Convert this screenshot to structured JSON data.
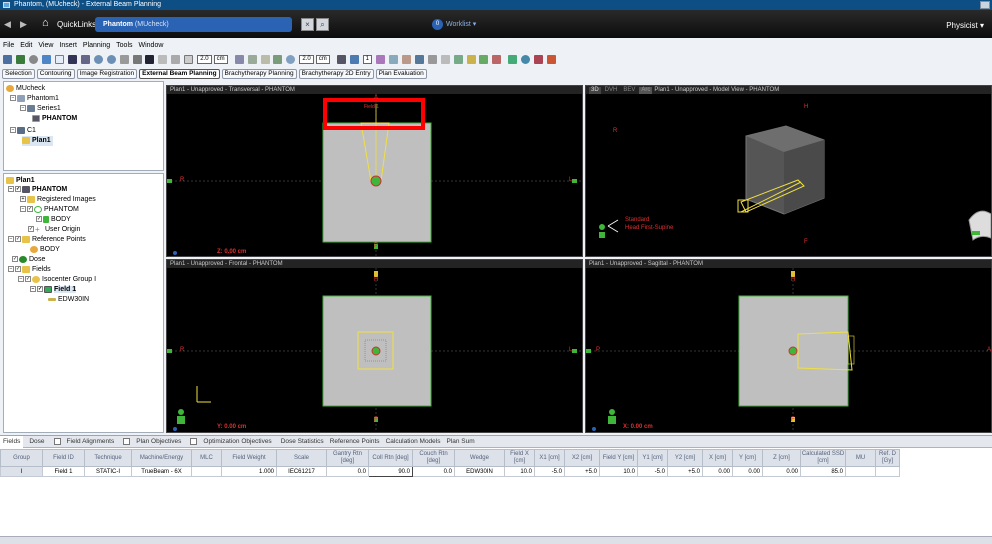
{
  "window": {
    "title": "Phantom, (MUcheck) - External Beam Planning"
  },
  "nav": {
    "quicklinks": "QuickLinks ▾",
    "patient_name": "Phantom",
    "patient_id": "(MUcheck)",
    "worklist": "Worklist ▾",
    "user_role": "Physicist ▾"
  },
  "menu": [
    "File",
    "Edit",
    "View",
    "Insert",
    "Planning",
    "Tools",
    "Window"
  ],
  "toolbar": {
    "zoom1": "2.0",
    "unit1": "cm",
    "zoom2": "2.0",
    "unit2": "cm",
    "count": "1"
  },
  "workspace_tabs": [
    {
      "label": "Selection",
      "active": false
    },
    {
      "label": "Contouring",
      "active": false
    },
    {
      "label": "Image Registration",
      "active": false
    },
    {
      "label": "External Beam Planning",
      "active": true
    },
    {
      "label": "Brachytherapy Planning",
      "active": false
    },
    {
      "label": "Brachytherapy 2D Entry",
      "active": false
    },
    {
      "label": "Plan Evaluation",
      "active": false
    }
  ],
  "scope_tree": {
    "items": [
      "MUcheck",
      "Phantom1",
      "Series1",
      "PHANTOM",
      "C1",
      "Plan1"
    ]
  },
  "plan_tree": {
    "header": "Plan1",
    "items": [
      "PHANTOM",
      "Registered Images",
      "PHANTOM",
      "BODY",
      "User Origin",
      "Reference Points",
      "BODY",
      "Dose",
      "Fields",
      "Isocenter Group I",
      "Field 1",
      "EDW30IN"
    ]
  },
  "viewports": {
    "transversal": {
      "title": "Plan1 - Unapproved - Transversal - PHANTOM",
      "marker": "Field 1",
      "top": "A",
      "bottom": "P",
      "left": "R",
      "right": "L",
      "coord": "Z: 0.00 cm"
    },
    "model": {
      "buttons": [
        "3D",
        "DVH",
        "BEV",
        "Arc"
      ],
      "title": "Plan1 - Unapproved - Model View - PHANTOM",
      "top": "H",
      "bottom": "F",
      "left": "R",
      "orient1": "Standard",
      "orient2": "Head First-Supine"
    },
    "frontal": {
      "title": "Plan1 - Unapproved - Frontal - PHANTOM",
      "top": "H",
      "bottom": "F",
      "left": "R",
      "right": "L",
      "coord": "Y: 0.00 cm"
    },
    "sagittal": {
      "title": "Plan1 - Unapproved - Sagittal - PHANTOM",
      "top": "H",
      "bottom": "F",
      "left": "P",
      "right": "A",
      "coord": "X: 0.00 cm"
    }
  },
  "bottom_tabs": [
    "Fields",
    "Dose",
    "Field Alignments",
    "Plan Objectives",
    "Optimization Objectives",
    "Dose Statistics",
    "Reference Points",
    "Calculation Models",
    "Plan Sum"
  ],
  "field_table": {
    "headers": [
      "Group",
      "Field ID",
      "Technique",
      "Machine/Energy",
      "MLC",
      "Field Weight",
      "Scale",
      "Gantry Rtn [deg]",
      "Coll Rtn [deg]",
      "Couch Rtn [deg]",
      "Wedge",
      "Field X [cm]",
      "X1 [cm]",
      "X2 [cm]",
      "Field Y [cm]",
      "Y1 [cm]",
      "Y2 [cm]",
      "X [cm]",
      "Y [cm]",
      "Z [cm]",
      "Calculated SSD [cm]",
      "MU",
      "Ref. D [Gy]"
    ],
    "rows": [
      [
        "I",
        "Field 1",
        "STATIC-I",
        "TrueBeam - 6X",
        "",
        "1.000",
        "IEC61217",
        "0.0",
        "90.0",
        "0.0",
        "EDW30IN",
        "10.0",
        "-5.0",
        "+5.0",
        "10.0",
        "-5.0",
        "+5.0",
        "0.00",
        "0.00",
        "0.00",
        "85.0",
        "",
        ""
      ]
    ]
  },
  "colors": {
    "accent": "#2a63b4",
    "structure": "#3fb63a",
    "beam": "#f0e040",
    "highlight": "#ff0000",
    "patient": "#bfbfbf"
  }
}
